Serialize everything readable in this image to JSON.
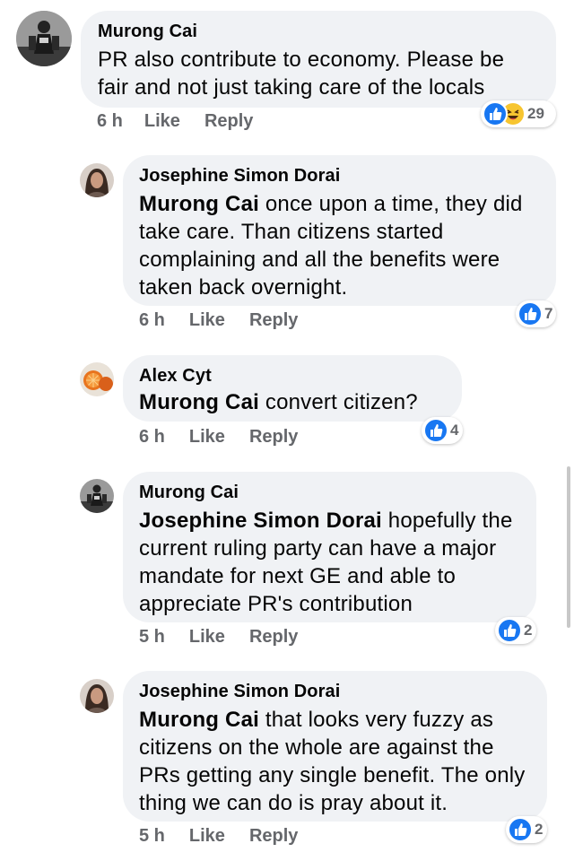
{
  "colors": {
    "bubble_bg": "#f0f2f5",
    "meta_text": "#65676b",
    "like_blue": "#1877f2",
    "haha_yellow": "#f7c530"
  },
  "comments": [
    {
      "author": "Murong Cai",
      "mention": "",
      "text": "PR also contribute to economy. Please be fair and not just taking care of the locals",
      "time": "6 h",
      "like_label": "Like",
      "reply_label": "Reply",
      "reaction_count": "29",
      "reaction_icons": [
        "like-icon",
        "haha-icon"
      ]
    },
    {
      "author": "Josephine Simon Dorai",
      "mention": "Murong Cai",
      "text": " once upon a time, they did take care. Than citizens started complaining and all the benefits were taken back overnight.",
      "time": "6 h",
      "like_label": "Like",
      "reply_label": "Reply",
      "reaction_count": "7",
      "reaction_icons": [
        "like-icon"
      ]
    },
    {
      "author": "Alex Cyt",
      "mention": "Murong Cai",
      "text": " convert citizen?",
      "time": "6 h",
      "like_label": "Like",
      "reply_label": "Reply",
      "reaction_count": "4",
      "reaction_icons": [
        "like-icon"
      ]
    },
    {
      "author": "Murong Cai",
      "mention": "Josephine Simon Dorai",
      "text": " hopefully the current ruling party can have a major mandate for next GE and able to appreciate PR's contribution",
      "time": "5 h",
      "like_label": "Like",
      "reply_label": "Reply",
      "reaction_count": "2",
      "reaction_icons": [
        "like-icon"
      ]
    },
    {
      "author": "Josephine Simon Dorai",
      "mention": "Murong Cai",
      "text": " that looks very fuzzy as citizens on the whole are against the PRs getting any single benefit. The only thing we can do is pray about it.",
      "time": "5 h",
      "like_label": "Like",
      "reply_label": "Reply",
      "reaction_count": "2",
      "reaction_icons": [
        "like-icon"
      ]
    }
  ]
}
